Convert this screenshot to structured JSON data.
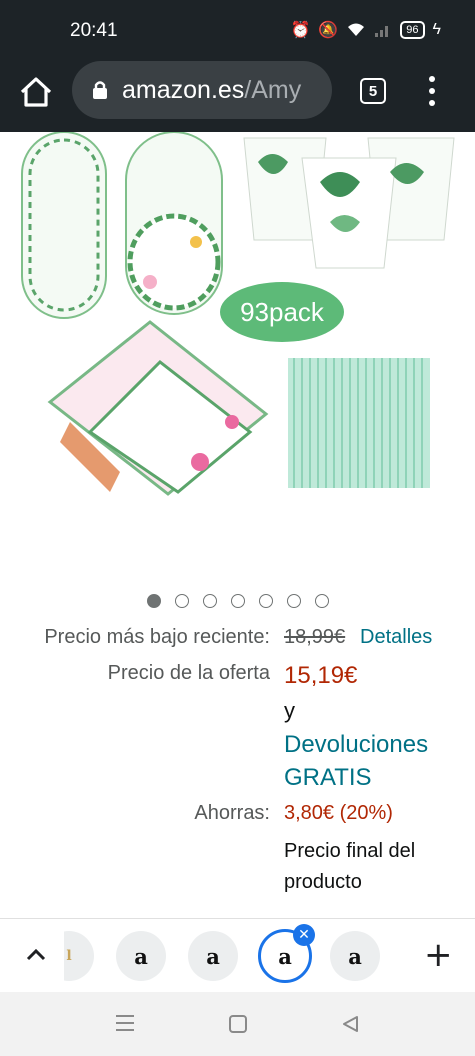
{
  "status": {
    "time": "20:41",
    "battery": "96"
  },
  "browser": {
    "url_host": "amazon.es",
    "url_path": "/Amy",
    "tab_count": "5"
  },
  "product": {
    "badge_text": "93pack",
    "carousel_total": 7,
    "carousel_active": 0
  },
  "pricing": {
    "lowest_label": "Precio más bajo reciente:",
    "lowest_price": "18,99€",
    "details_link": "Detalles",
    "offer_label": "Precio de la oferta",
    "offer_price": "15,19€",
    "conjunction": "y",
    "returns": "Devoluciones GRATIS",
    "savings_label": "Ahorras:",
    "savings_value": "3,80€ (20%)",
    "final_note": "Precio final del producto"
  },
  "tabs": {
    "favicon_letter": "a",
    "items": [
      "partial",
      "amazon",
      "amazon",
      "amazon-selected",
      "amazon"
    ]
  },
  "colors": {
    "price_red": "#b12704",
    "link_teal": "#007185",
    "chrome_dark": "#1d2327",
    "selected_tab": "#1a73e8"
  }
}
